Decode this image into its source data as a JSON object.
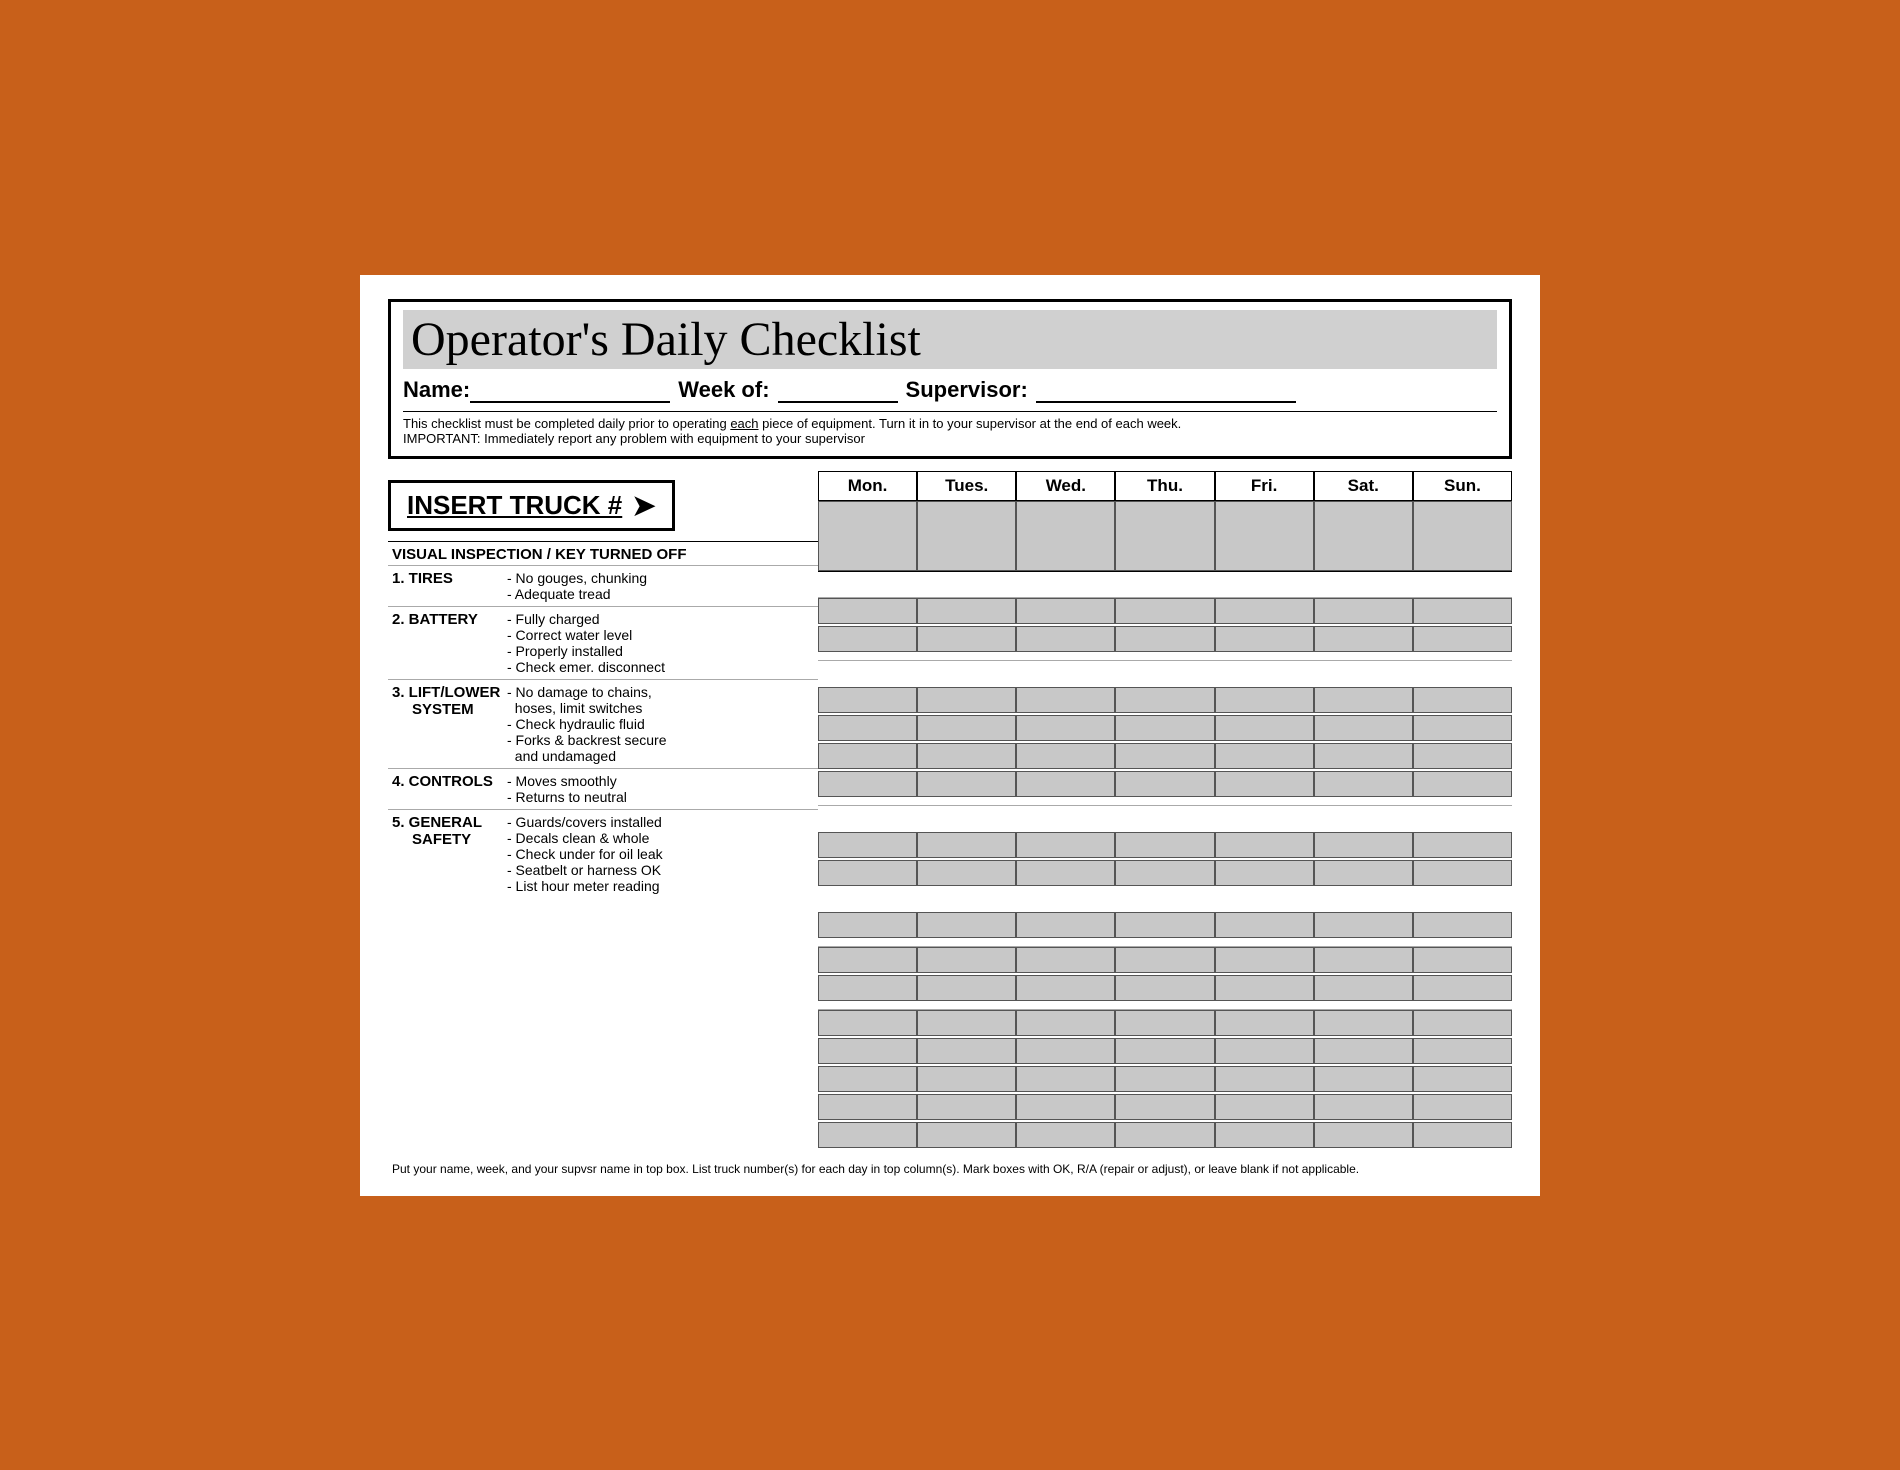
{
  "page": {
    "title": "Operator's Daily Checklist",
    "fields": {
      "name_label": "Name:",
      "week_label": "Week of:",
      "supervisor_label": "Supervisor:"
    },
    "instructions": [
      "This checklist must be completed daily prior to operating",
      "each",
      "piece of equipment.  Turn it in to your supervisor at the end of each week.",
      "IMPORTANT:  Immediately report any problem with equipment to your supervisor"
    ],
    "truck_box": {
      "text": "INSERT TRUCK #",
      "arrow": "➤"
    },
    "days": [
      "Mon.",
      "Tues.",
      "Wed.",
      "Thu.",
      "Fri.",
      "Sat.",
      "Sun."
    ],
    "vi_header": "VISUAL INSPECTION / KEY TURNED OFF",
    "sections": [
      {
        "number": "1.",
        "name": "TIRES",
        "items": [
          "- No gouges, chunking",
          "- Adequate tread"
        ]
      },
      {
        "number": "2.",
        "name": "BATTERY",
        "items": [
          "- Fully charged",
          "- Correct water level",
          "- Properly installed",
          "- Check emer. disconnect"
        ]
      },
      {
        "number": "3.",
        "name": "LIFT/LOWER",
        "name2": "SYSTEM",
        "items": [
          "- No damage to chains,",
          "  hoses, limit switches",
          "- Check hydraulic fluid",
          "- Forks & backrest secure",
          "  and undamaged"
        ]
      },
      {
        "number": "4.",
        "name": "CONTROLS",
        "items": [
          "- Moves smoothly",
          "- Returns to neutral"
        ]
      },
      {
        "number": "5.",
        "name": "GENERAL",
        "name2": "SAFETY",
        "items": [
          "- Guards/covers installed",
          "- Decals clean & whole",
          "- Check under for oil leak",
          "- Seatbelt or harness OK",
          "- List hour meter reading"
        ]
      }
    ],
    "footer": "Put your name, week, and your supvsr name in top box.  List truck number(s) for each day in top column(s).  Mark boxes with OK, R/A (repair or adjust), or leave blank if not applicable."
  }
}
